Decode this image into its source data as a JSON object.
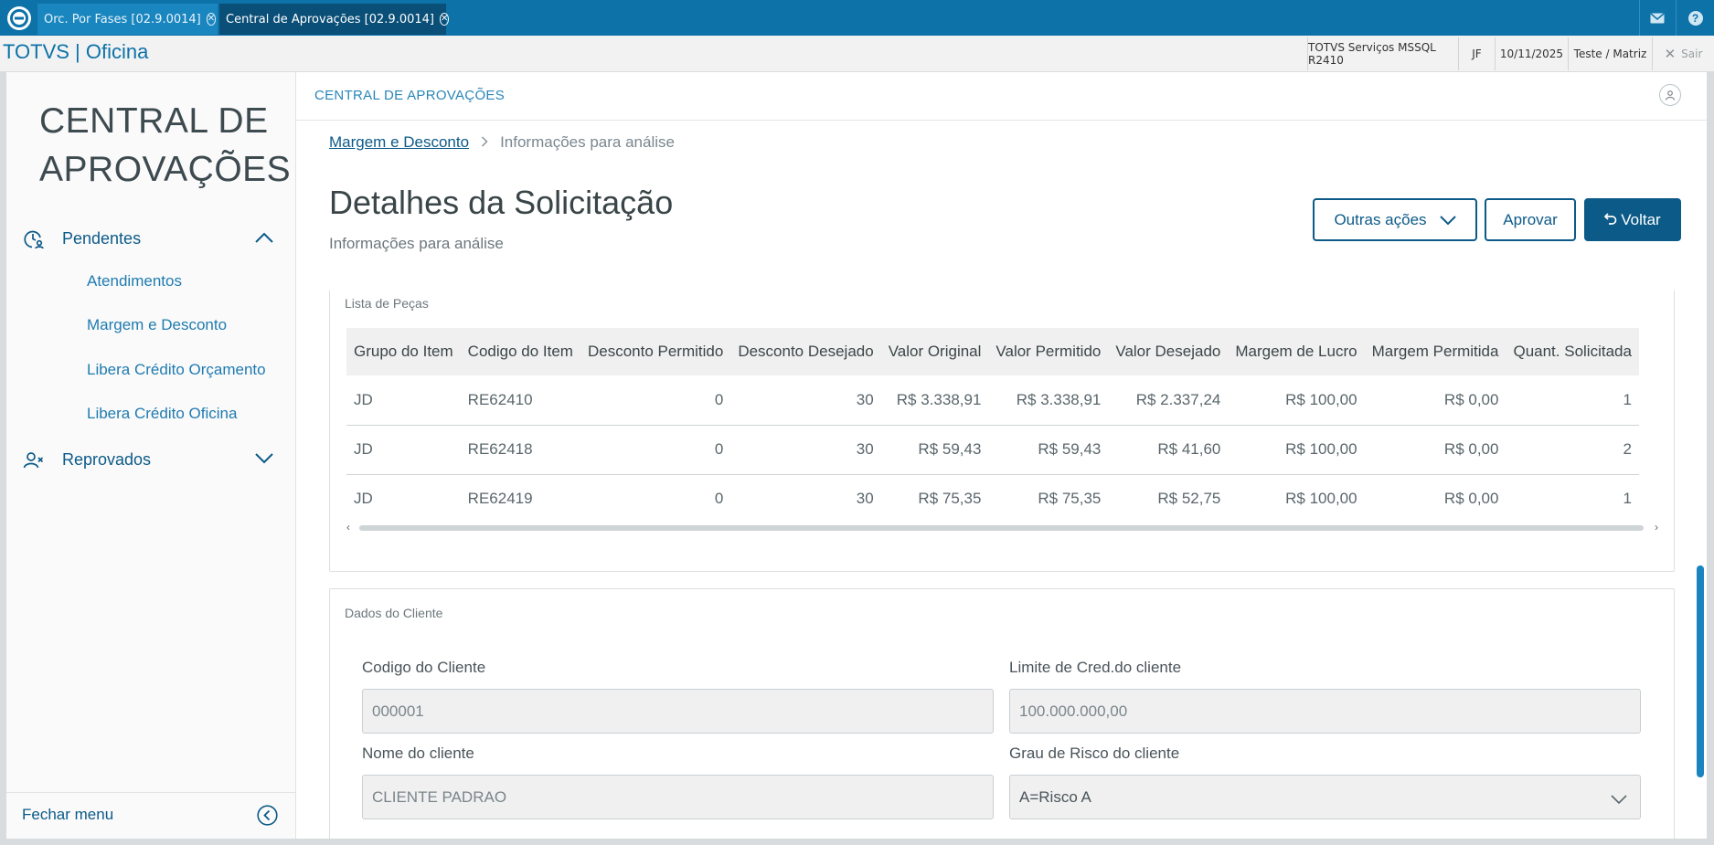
{
  "tabs": [
    {
      "label": "Orc. Por Fases [02.9.0014]"
    },
    {
      "label": "Central de Aprovações [02.9.0014]"
    }
  ],
  "brand": "TOTVS | Oficina",
  "info": {
    "environment": "TOTVS Serviços MSSQL R2410",
    "user": "JF",
    "date": "10/11/2025",
    "branch": "Teste / Matriz",
    "logout": "Sair"
  },
  "sidebar": {
    "title_line1": "CENTRAL DE",
    "title_line2": "APROVAÇÕES",
    "groups": [
      {
        "label": "Pendentes",
        "expanded": true,
        "items": [
          {
            "label": "Atendimentos"
          },
          {
            "label": "Margem e Desconto"
          },
          {
            "label": "Libera Crédito Orçamento"
          },
          {
            "label": "Libera Crédito Oficina"
          }
        ]
      },
      {
        "label": "Reprovados",
        "expanded": false
      }
    ],
    "footer": "Fechar menu"
  },
  "main": {
    "header": "CENTRAL DE APROVAÇÕES",
    "breadcrumb": {
      "link": "Margem e Desconto",
      "current": "Informações para análise"
    },
    "title": "Detalhes da Solicitação",
    "subtitle": "Informações para análise",
    "actions": {
      "more": "Outras ações",
      "approve": "Aprovar",
      "back": "Voltar"
    },
    "parts": {
      "legend": "Lista de Peças",
      "columns": [
        "Grupo do Item",
        "Codigo do Item",
        "Desconto Permitido",
        "Desconto Desejado",
        "Valor Original",
        "Valor Permitido",
        "Valor Desejado",
        "Margem de Lucro",
        "Margem Permitida",
        "Quant. Solicitada"
      ],
      "rows": [
        [
          "JD",
          "RE62410",
          "0",
          "30",
          "R$ 3.338,91",
          "R$ 3.338,91",
          "R$ 2.337,24",
          "R$ 100,00",
          "R$ 0,00",
          "1"
        ],
        [
          "JD",
          "RE62418",
          "0",
          "30",
          "R$ 59,43",
          "R$ 59,43",
          "R$ 41,60",
          "R$ 100,00",
          "R$ 0,00",
          "2"
        ],
        [
          "JD",
          "RE62419",
          "0",
          "30",
          "R$ 75,35",
          "R$ 75,35",
          "R$ 52,75",
          "R$ 100,00",
          "R$ 0,00",
          "1"
        ]
      ]
    },
    "client": {
      "legend": "Dados do Cliente",
      "code_label": "Codigo do Cliente",
      "code_value": "000001",
      "limit_label": "Limite de Cred.do cliente",
      "limit_value": "100.000.000,00",
      "name_label": "Nome do cliente",
      "name_value": "CLIENTE PADRAO",
      "risk_label": "Grau de Risco do cliente",
      "risk_value": "A=Risco A"
    }
  },
  "colors": {
    "primary": "#0c5a88",
    "topbar": "#0c72a8",
    "active_tab": "#0a4f78"
  }
}
